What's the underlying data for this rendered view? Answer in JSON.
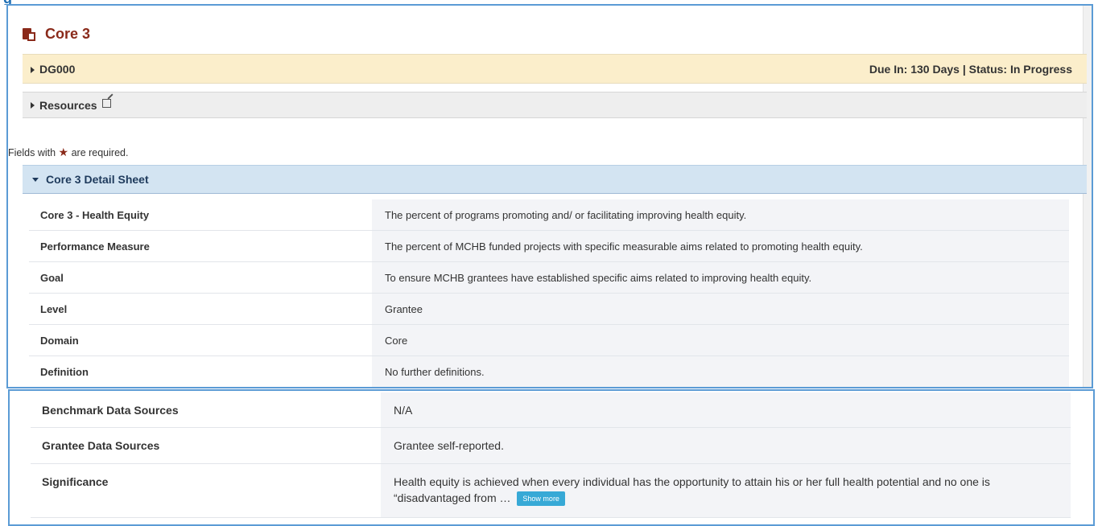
{
  "top_fragment": "g",
  "page_title": "Core 3",
  "dg_bar": {
    "label": "DG000",
    "status": "Due In: 130 Days | Status: In Progress"
  },
  "resources_bar": {
    "label": "Resources"
  },
  "required_note": {
    "prefix": "Fields with",
    "suffix": "are required."
  },
  "detail_sheet": {
    "title": "Core 3 Detail Sheet",
    "rows": [
      {
        "label": "Core 3 - Health Equity",
        "value": "The percent of programs promoting and/ or facilitating improving health equity."
      },
      {
        "label": "Performance Measure",
        "value": "The percent of MCHB funded projects with specific measurable aims related to promoting health equity."
      },
      {
        "label": "Goal",
        "value": "To ensure MCHB grantees have established specific aims related to improving health equity."
      },
      {
        "label": "Level",
        "value": "Grantee"
      },
      {
        "label": "Domain",
        "value": "Core"
      },
      {
        "label": "Definition",
        "value": "No further definitions."
      }
    ],
    "rows_continued": [
      {
        "label": "Benchmark Data Sources",
        "value": "N/A"
      },
      {
        "label": "Grantee Data Sources",
        "value": "Grantee self-reported."
      },
      {
        "label": "Significance",
        "value": "Health equity is achieved when every individual has the opportunity to attain his or her full health potential and no one is “disadvantaged from …",
        "show_more": "Show more"
      }
    ]
  },
  "colors": {
    "title": "#8a2a1a",
    "dg_bar_bg": "#fbeecb",
    "sheet_header_bg": "#d3e4f2",
    "frame_border": "#5b9bd5",
    "show_more_bg": "#37a9d6"
  }
}
